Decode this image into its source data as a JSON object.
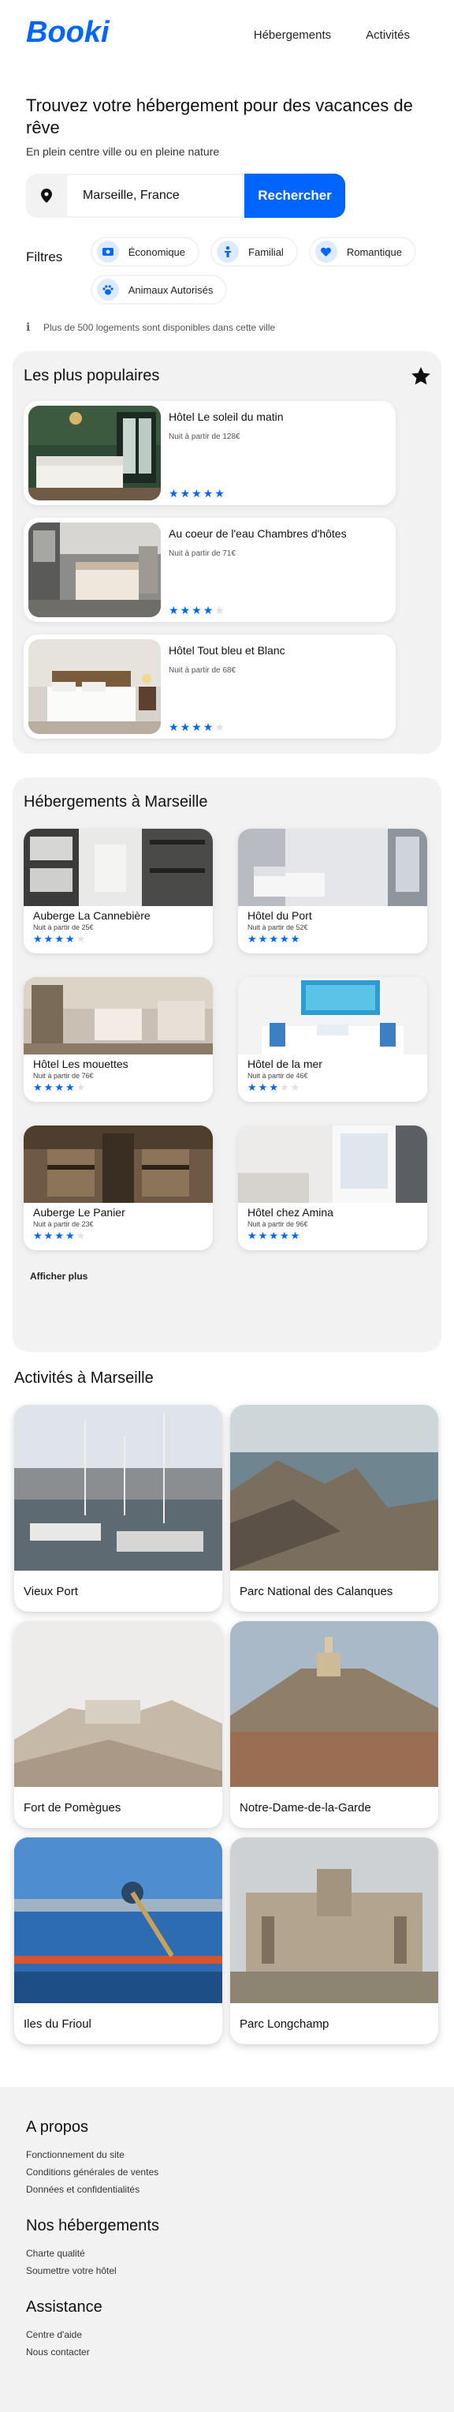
{
  "header": {
    "logo": "Booki",
    "nav": [
      "Hébergements",
      "Activités"
    ]
  },
  "hero": {
    "title": "Trouvez votre hébergement pour des vacances de rêve",
    "subtitle": "En plein centre ville ou en pleine nature",
    "search_value": "Marseille, France",
    "search_button": "Rechercher"
  },
  "filters": {
    "label": "Filtres",
    "chips": [
      {
        "label": "Économique",
        "icon": "money-icon"
      },
      {
        "label": "Familial",
        "icon": "child-icon"
      },
      {
        "label": "Romantique",
        "icon": "heart-icon"
      },
      {
        "label": "Animaux Autorisés",
        "icon": "paw-icon"
      }
    ],
    "info": "Plus de 500 logements sont disponibles dans cette ville"
  },
  "popular": {
    "title": "Les plus populaires",
    "items": [
      {
        "name": "Hôtel Le soleil du matin",
        "price": "Nuit à partir de 128€",
        "rating": 5
      },
      {
        "name": "Au coeur de l'eau Chambres d'hôtes",
        "price": "Nuit à partir de 71€",
        "rating": 4
      },
      {
        "name": "Hôtel Tout bleu et Blanc",
        "price": "Nuit à partir de 68€",
        "rating": 4
      }
    ]
  },
  "hebergements": {
    "title": "Hébergements à Marseille",
    "items": [
      {
        "name": "Auberge La Cannebière",
        "price": "Nuit à partir de 25€",
        "rating": 4
      },
      {
        "name": "Hôtel du Port",
        "price": "Nuit à partir de 52€",
        "rating": 5
      },
      {
        "name": "Hôtel Les mouettes",
        "price": "Nuit à partir de 76€",
        "rating": 4
      },
      {
        "name": "Hôtel de la mer",
        "price": "Nuit à partir de 46€",
        "rating": 3
      },
      {
        "name": "Auberge Le Panier",
        "price": "Nuit à partir de 23€",
        "rating": 4
      },
      {
        "name": "Hôtel chez Amina",
        "price": "Nuit à partir de 96€",
        "rating": 5
      }
    ],
    "more": "Afficher plus"
  },
  "activites": {
    "title": "Activités à Marseille",
    "items": [
      {
        "label": "Vieux Port"
      },
      {
        "label": "Parc National des Calanques"
      },
      {
        "label": "Fort de Pomègues"
      },
      {
        "label": "Notre-Dame-de-la-Garde"
      },
      {
        "label": "Iles du Frioul"
      },
      {
        "label": "Parc Longchamp"
      }
    ]
  },
  "footer": {
    "sections": [
      {
        "title": "A propos",
        "links": [
          "Fonctionnement du site",
          "Conditions générales de ventes",
          "Données et confidentialités"
        ]
      },
      {
        "title": "Nos hébergements",
        "links": [
          "Charte qualité",
          "Soumettre votre hôtel"
        ]
      },
      {
        "title": "Assistance",
        "links": [
          "Centre d'aide",
          "Nous contacter"
        ]
      }
    ]
  },
  "colors": {
    "primary": "#0065FC",
    "light_blue": "#DEEBFF",
    "panel": "#F2F2F2"
  }
}
